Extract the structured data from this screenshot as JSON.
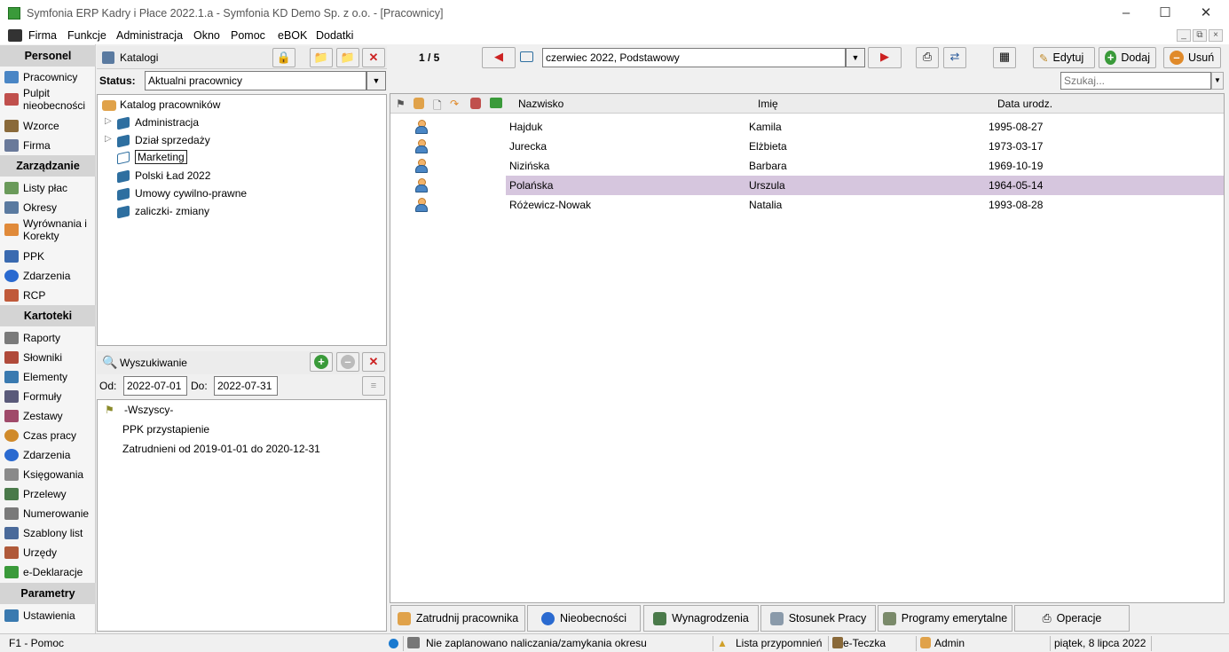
{
  "window": {
    "title": "Symfonia ERP Kadry i Płace 2022.1.a - Symfonia KD Demo Sp. z o.o. - [Pracownicy]"
  },
  "menu": [
    "Firma",
    "Funkcje",
    "Administracja",
    "Okno",
    "Pomoc",
    "eBOK",
    "Dodatki"
  ],
  "sidebar": {
    "sections": [
      "Personel",
      "Zarządzanie",
      "Kartoteki",
      "Parametry"
    ],
    "personel": [
      "Pracownicy",
      "Pulpit nieobecności",
      "Wzorce",
      "Firma"
    ],
    "zarzadzanie": [
      "Listy płac",
      "Okresy",
      "Wyrównania i Korekty",
      "PPK",
      "Zdarzenia",
      "RCP"
    ],
    "kartoteki": [
      "Raporty",
      "Słowniki",
      "Elementy",
      "Formuły",
      "Zestawy",
      "Czas pracy",
      "Zdarzenia",
      "Księgowania",
      "Przelewy",
      "Numerowanie",
      "Szablony list",
      "Urzędy",
      "e-Deklaracje"
    ],
    "parametry": [
      "Ustawienia"
    ]
  },
  "katalogi": {
    "title": "Katalogi",
    "status_label": "Status:",
    "status_value": "Aktualni pracownicy",
    "root": "Katalog pracowników",
    "items": [
      "Administracja",
      "Dział sprzedaży",
      "Marketing",
      "Polski Ład 2022",
      "Umowy cywilno-prawne",
      "zaliczki- zmiany"
    ]
  },
  "search": {
    "title": "Wyszukiwanie",
    "od_label": "Od:",
    "od_value": "2022-07-01",
    "do_label": "Do:",
    "do_value": "2022-07-31",
    "items": [
      "-Wszyscy-",
      "PPK przystapienie",
      "Zatrudnieni od 2019-01-01 do 2020-12-31"
    ]
  },
  "toolbar": {
    "counter": "1 / 5",
    "period": "czerwiec 2022, Podstawowy",
    "edit": "Edytuj",
    "add": "Dodaj",
    "delete": "Usuń",
    "search_placeholder": "Szukaj..."
  },
  "table": {
    "columns": [
      "Nazwisko",
      "Imię",
      "Data urodz."
    ],
    "rows": [
      [
        "Hajduk",
        "Kamila",
        "1995-08-27"
      ],
      [
        "Jurecka",
        "Elżbieta",
        "1973-03-17"
      ],
      [
        "Nizińska",
        "Barbara",
        "1969-10-19"
      ],
      [
        "Polańska",
        "Urszula",
        "1964-05-14"
      ],
      [
        "Różewicz-Nowak",
        "Natalia",
        "1993-08-28"
      ]
    ],
    "selected_index": 3
  },
  "bottom_buttons": [
    "Zatrudnij pracownika",
    "Nieobecności",
    "Wynagrodzenia",
    "Stosunek Pracy",
    "Programy emerytalne",
    "Operacje"
  ],
  "statusbar": {
    "help": "F1 - Pomoc",
    "message": "Nie zaplanowano naliczania/zamykania okresu",
    "reminders": "Lista przypomnień",
    "eteczka": "e-Teczka",
    "user": "Admin",
    "date": "piątek, 8 lipca 2022"
  },
  "colors": {
    "selected_row": "#d6c6de",
    "accent_red": "#cc2222",
    "accent_green": "#3a9a3a"
  }
}
